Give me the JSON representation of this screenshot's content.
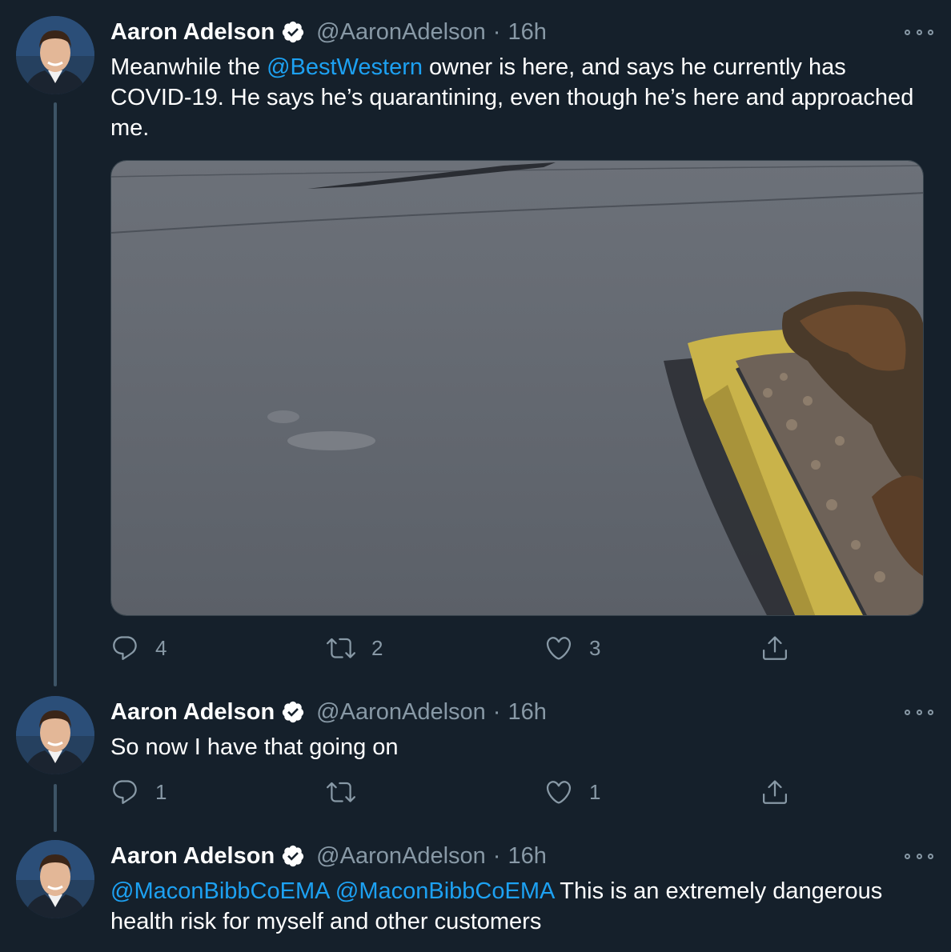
{
  "tweets": [
    {
      "author": {
        "name": "Aaron Adelson",
        "handle": "@AaronAdelson",
        "time": "16h",
        "verified": true
      },
      "text": {
        "before": "Meanwhile the ",
        "mention": "@BestWestern",
        "after": " owner is here, and says he currently has COVID-19.  He says he’s quarantining, even though he’s here and approached me."
      },
      "has_media": true,
      "actions": {
        "reply_count": "4",
        "retweet_count": "2",
        "like_count": "3"
      }
    },
    {
      "author": {
        "name": "Aaron Adelson",
        "handle": "@AaronAdelson",
        "time": "16h",
        "verified": true
      },
      "text": "So now I have that going on",
      "actions": {
        "reply_count": "1",
        "retweet_count": "",
        "like_count": "1"
      }
    },
    {
      "author": {
        "name": "Aaron Adelson",
        "handle": "@AaronAdelson",
        "time": "16h",
        "verified": true
      },
      "text": {
        "mention1": "@MaconBibbCoEMA",
        "mention2": "@MaconBibbCoEMA",
        "after": " This is an extremely dangerous health risk for myself and other customers"
      }
    }
  ],
  "separator": "·",
  "icons": {
    "verified": "verified-badge-icon",
    "more": "more-options-icon",
    "reply": "reply-icon",
    "retweet": "retweet-icon",
    "like": "heart-icon",
    "share": "share-icon"
  },
  "colors": {
    "background": "#15202b",
    "text": "#ffffff",
    "muted": "#8899a6",
    "link": "#1da1f2",
    "thread_line": "#3d5466"
  }
}
